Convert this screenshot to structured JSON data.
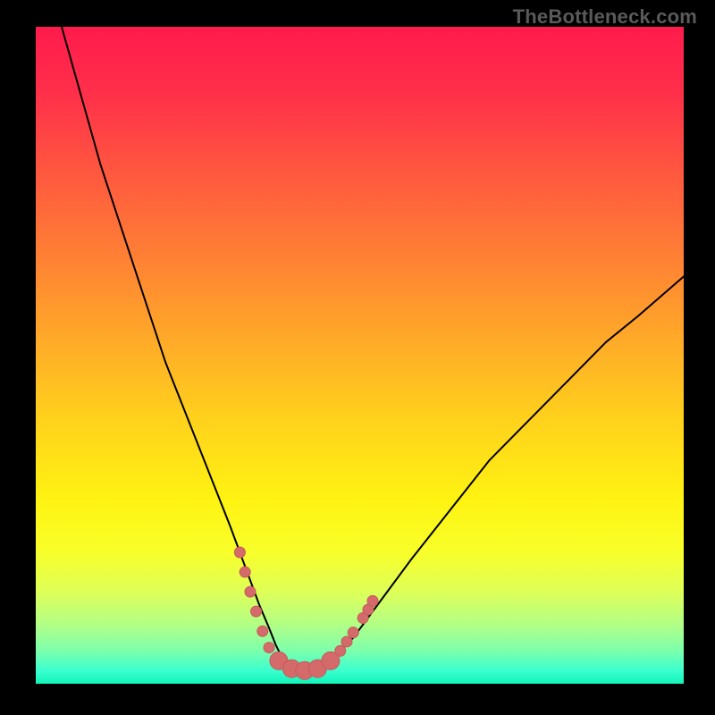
{
  "watermark": "TheBottleneck.com",
  "chart_data": {
    "type": "line",
    "title": "",
    "xlabel": "",
    "ylabel": "",
    "xlim": [
      0,
      100
    ],
    "ylim": [
      0,
      100
    ],
    "axes_visible": false,
    "grid": false,
    "background_gradient": {
      "direction": "vertical",
      "stops": [
        {
          "offset": 0.0,
          "color": "#ff1b4c"
        },
        {
          "offset": 0.1,
          "color": "#ff2f4a"
        },
        {
          "offset": 0.22,
          "color": "#ff5740"
        },
        {
          "offset": 0.35,
          "color": "#ff8034"
        },
        {
          "offset": 0.48,
          "color": "#ffab28"
        },
        {
          "offset": 0.6,
          "color": "#ffd21c"
        },
        {
          "offset": 0.72,
          "color": "#fff312"
        },
        {
          "offset": 0.8,
          "color": "#f8ff2a"
        },
        {
          "offset": 0.86,
          "color": "#deff58"
        },
        {
          "offset": 0.91,
          "color": "#b2ff86"
        },
        {
          "offset": 0.95,
          "color": "#7cffac"
        },
        {
          "offset": 0.98,
          "color": "#3bffcf"
        },
        {
          "offset": 1.0,
          "color": "#10f5b9"
        }
      ]
    },
    "series": [
      {
        "name": "bottleneck-curve",
        "stroke": "#000000",
        "stroke_width": 2,
        "x": [
          4,
          6,
          8,
          10,
          12,
          14,
          16,
          18,
          20,
          22,
          24,
          26,
          28,
          30,
          31.5,
          33,
          34.5,
          36,
          37,
          38,
          39,
          40,
          42,
          44,
          46,
          49,
          52,
          55,
          58,
          62,
          66,
          70,
          74,
          78,
          83,
          88,
          93,
          100
        ],
        "y": [
          100,
          93,
          86,
          79,
          73,
          67,
          61,
          55,
          49,
          44,
          39,
          34,
          29,
          24,
          20,
          16,
          12,
          8.5,
          6,
          4,
          2.5,
          2,
          2,
          2.5,
          4,
          7,
          11,
          15,
          19,
          24,
          29,
          34,
          38,
          42,
          47,
          52,
          56,
          62
        ]
      }
    ],
    "markers": {
      "color": "#d46a6a",
      "stroke": "#c85a5a",
      "radius_small": 6,
      "radius_large": 10,
      "points": [
        {
          "x": 31.5,
          "y": 20,
          "size": "small"
        },
        {
          "x": 32.3,
          "y": 17,
          "size": "small"
        },
        {
          "x": 33.1,
          "y": 14,
          "size": "small"
        },
        {
          "x": 34.0,
          "y": 11,
          "size": "small"
        },
        {
          "x": 35.0,
          "y": 8,
          "size": "small"
        },
        {
          "x": 36.0,
          "y": 5.5,
          "size": "small"
        },
        {
          "x": 37.5,
          "y": 3.5,
          "size": "large"
        },
        {
          "x": 39.5,
          "y": 2.3,
          "size": "large"
        },
        {
          "x": 41.5,
          "y": 2.0,
          "size": "large"
        },
        {
          "x": 43.5,
          "y": 2.3,
          "size": "large"
        },
        {
          "x": 45.5,
          "y": 3.5,
          "size": "large"
        },
        {
          "x": 47.0,
          "y": 5.0,
          "size": "small"
        },
        {
          "x": 48.0,
          "y": 6.4,
          "size": "small"
        },
        {
          "x": 49.0,
          "y": 7.8,
          "size": "small"
        },
        {
          "x": 50.5,
          "y": 10.0,
          "size": "small"
        },
        {
          "x": 51.3,
          "y": 11.3,
          "size": "small"
        },
        {
          "x": 52.0,
          "y": 12.6,
          "size": "small"
        }
      ]
    }
  }
}
